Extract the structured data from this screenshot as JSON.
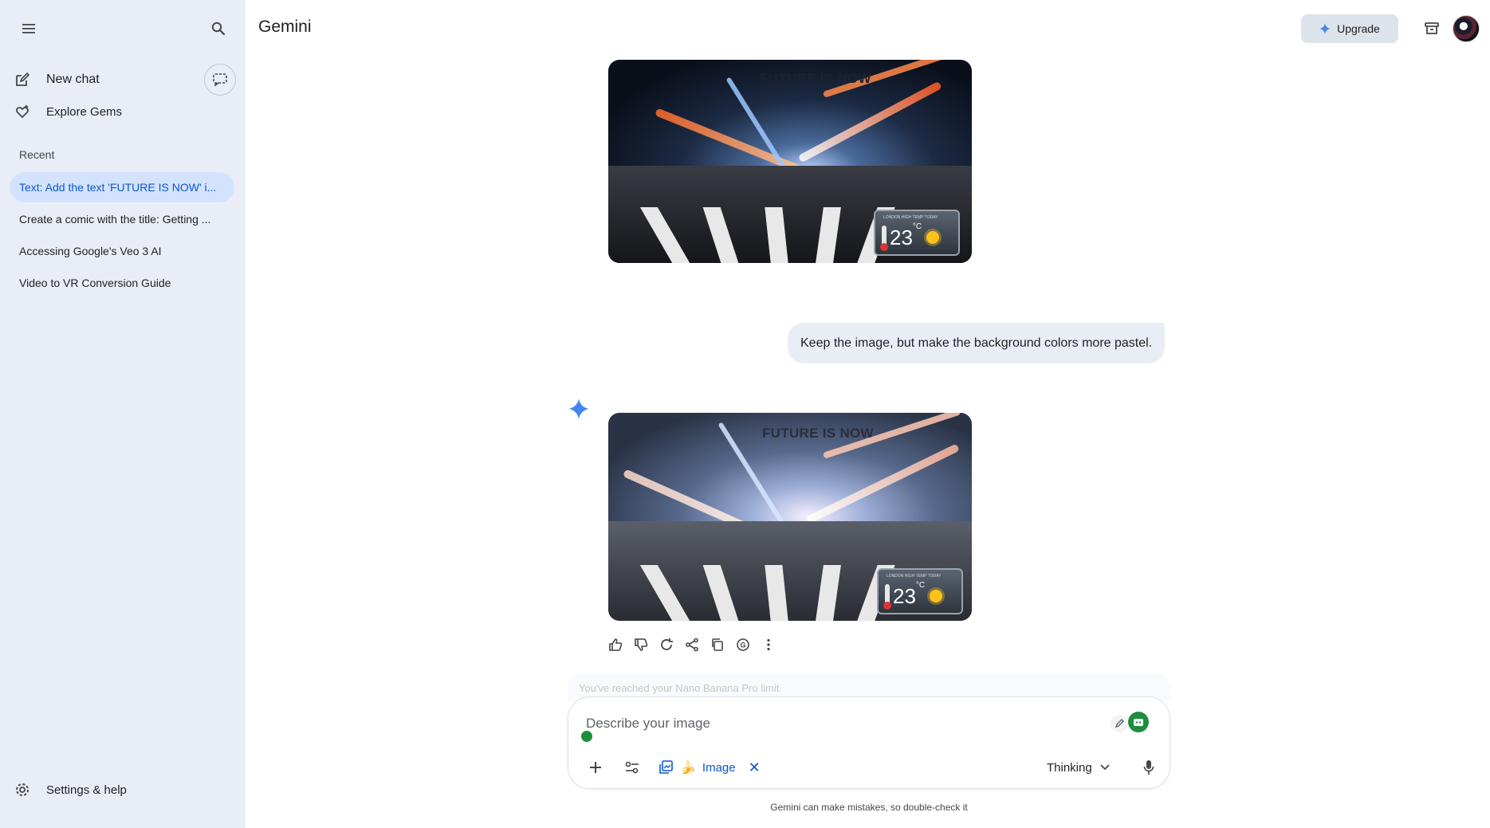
{
  "app": {
    "title": "Gemini"
  },
  "sidebar": {
    "new_chat": "New chat",
    "explore_gems": "Explore Gems",
    "recent_label": "Recent",
    "recent_items": [
      {
        "label": "Text: Add the text 'FUTURE IS NOW' i...",
        "active": true
      },
      {
        "label": "Create a comic with the title: Getting ...",
        "active": false
      },
      {
        "label": "Accessing Google's Veo 3 AI",
        "active": false
      },
      {
        "label": "Video to VR Conversion Guide",
        "active": false
      }
    ],
    "settings": "Settings & help"
  },
  "header": {
    "upgrade_label": "Upgrade"
  },
  "conversation": {
    "image_1": {
      "overlay_text": "FUTURE IS NOW",
      "widget_label": "LONDON HIGH TEMP TODAY",
      "temp": "23",
      "unit": "°C"
    },
    "user_message": "Keep the image, but make the background colors more pastel.",
    "image_2": {
      "overlay_text": "FUTURE IS NOW",
      "widget_label": "LONDON HIGH TEMP TODAY",
      "temp": "23",
      "unit": "°C"
    }
  },
  "composer": {
    "limit_notice": "You've reached your Nano Banana Pro limit",
    "placeholder": "Describe your image",
    "image_chip_label": "Image",
    "model_label": "Thinking"
  },
  "footer": {
    "disclaimer": "Gemini can make mistakes, so double-check it"
  },
  "colors": {
    "sidebar_bg": "#e9eef6",
    "accent": "#0b57d0",
    "active_item_bg": "#d3e3fd"
  }
}
